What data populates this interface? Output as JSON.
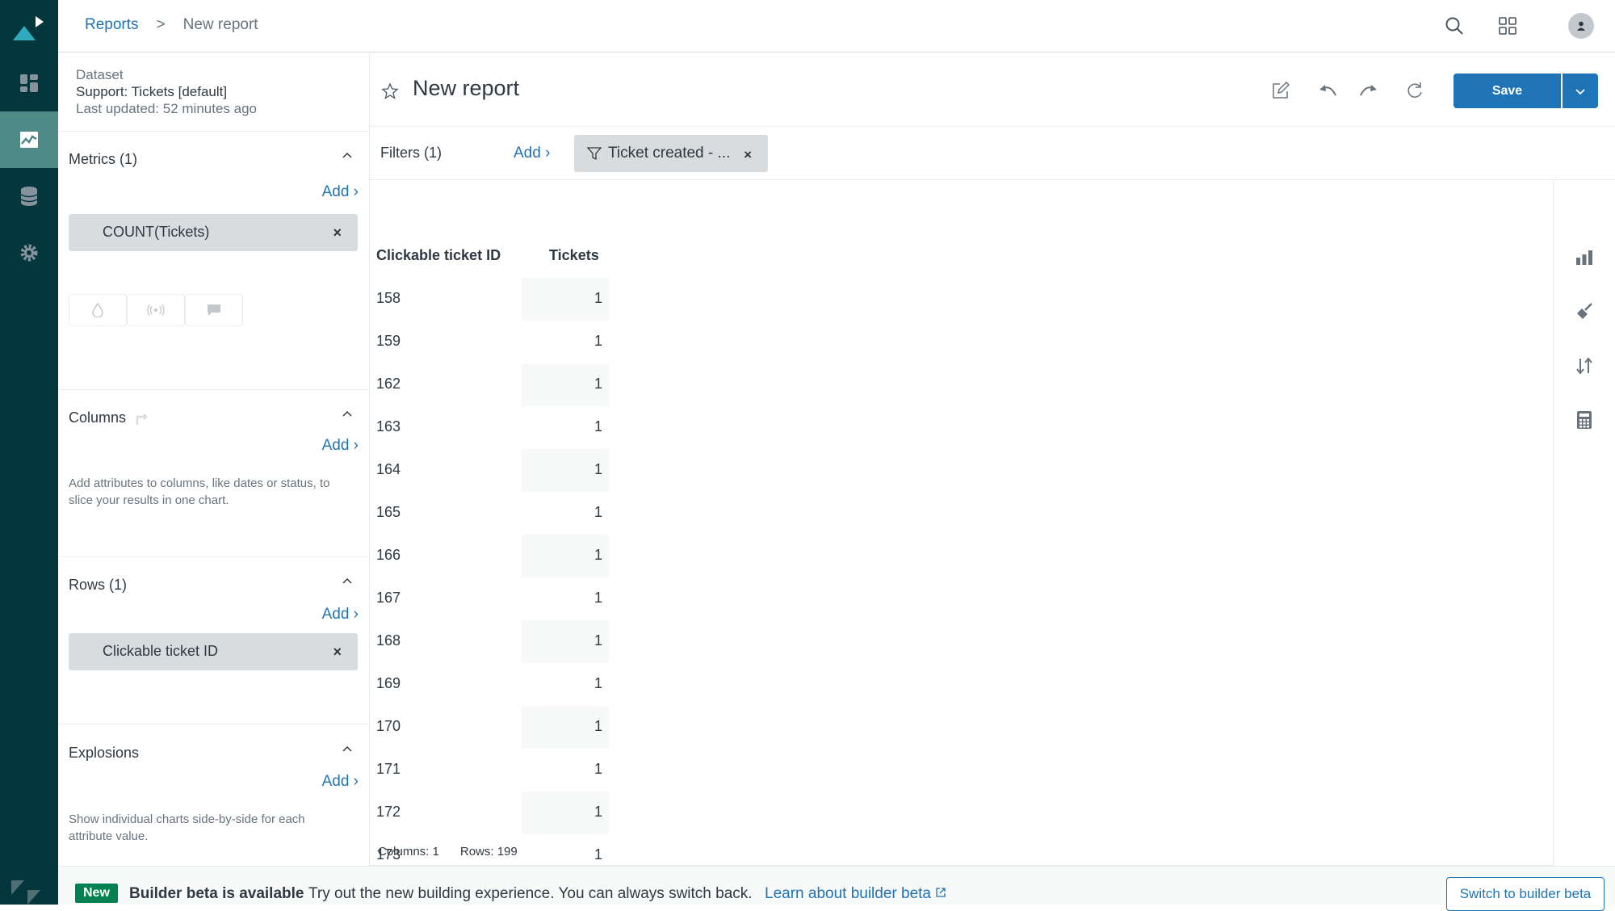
{
  "colors": {
    "nav_bg": "#03363d",
    "nav_active": "#4f8a87",
    "accent": "#1f73b7",
    "badge": "#038153",
    "pill": "#d8dcde"
  },
  "breadcrumb": {
    "parent": "Reports",
    "separator": ">",
    "current": "New report"
  },
  "top_icons": [
    "search-icon",
    "apps-grid-icon",
    "user-avatar-icon"
  ],
  "nav": {
    "items": [
      "home-logo",
      "dashboards-icon",
      "reports-icon",
      "datasets-icon",
      "settings-icon"
    ],
    "active": "reports-icon"
  },
  "dataset": {
    "label": "Dataset",
    "name": "Support: Tickets [default]",
    "updated": "Last updated: 52 minutes ago"
  },
  "panel": {
    "metrics": {
      "title": "Metrics (1)",
      "add": "Add",
      "items": [
        "COUNT(Tickets)"
      ]
    },
    "columns": {
      "title": "Columns",
      "add": "Add",
      "hint": "Add attributes to columns, like dates or status, to slice your results in one chart."
    },
    "rows": {
      "title": "Rows (1)",
      "add": "Add",
      "items": [
        "Clickable ticket ID"
      ]
    },
    "explosions": {
      "title": "Explosions",
      "add": "Add",
      "hint": "Show individual charts side-by-side for each attribute value."
    }
  },
  "report": {
    "title": "New report",
    "save": "Save"
  },
  "filters": {
    "label": "Filters (1)",
    "add": "Add",
    "items": [
      "Ticket created - ..."
    ]
  },
  "table": {
    "headers": [
      "Clickable ticket ID",
      "Tickets"
    ],
    "rows": [
      [
        "158",
        "1"
      ],
      [
        "159",
        "1"
      ],
      [
        "162",
        "1"
      ],
      [
        "163",
        "1"
      ],
      [
        "164",
        "1"
      ],
      [
        "165",
        "1"
      ],
      [
        "166",
        "1"
      ],
      [
        "167",
        "1"
      ],
      [
        "168",
        "1"
      ],
      [
        "169",
        "1"
      ],
      [
        "170",
        "1"
      ],
      [
        "171",
        "1"
      ],
      [
        "172",
        "1"
      ],
      [
        "173",
        "1"
      ]
    ],
    "summary": {
      "columns": "Columns: 1",
      "rows": "Rows: 199"
    }
  },
  "banner": {
    "badge": "New",
    "title": "Builder beta is available",
    "description": "Try out the new building experience. You can always switch back.",
    "link": "Learn about builder beta",
    "button": "Switch to builder beta"
  }
}
